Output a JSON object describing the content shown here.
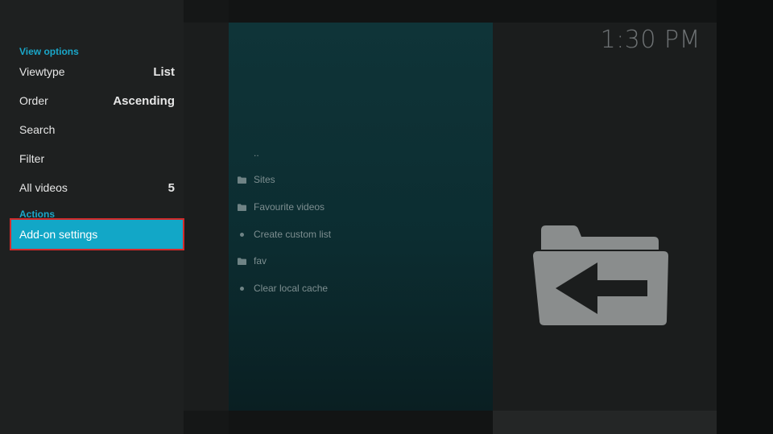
{
  "clock": "1:30 PM",
  "side_menu": {
    "view_options_header": "View options",
    "viewtype": {
      "label": "Viewtype",
      "value": "List"
    },
    "order": {
      "label": "Order",
      "value": "Ascending"
    },
    "search": {
      "label": "Search"
    },
    "filter": {
      "label": "Filter"
    },
    "all_videos": {
      "label": "All videos",
      "value": "5"
    },
    "actions_header": "Actions",
    "addon_settings": {
      "label": "Add-on settings",
      "selected": true
    }
  },
  "list": {
    "items": [
      {
        "label": "..",
        "icon": "none"
      },
      {
        "label": "Sites",
        "icon": "folder-icon"
      },
      {
        "label": "Favourite videos",
        "icon": "folder-icon"
      },
      {
        "label": "Create custom list",
        "icon": "bullet-icon"
      },
      {
        "label": "fav",
        "icon": "folder-icon"
      },
      {
        "label": "Clear local cache",
        "icon": "bullet-icon"
      }
    ]
  },
  "preview": {
    "icon": "folder-back-icon"
  },
  "colors": {
    "accent": "#12a7c7",
    "highlight_outline": "#d42b2b",
    "section_header": "#1aa7c9"
  }
}
